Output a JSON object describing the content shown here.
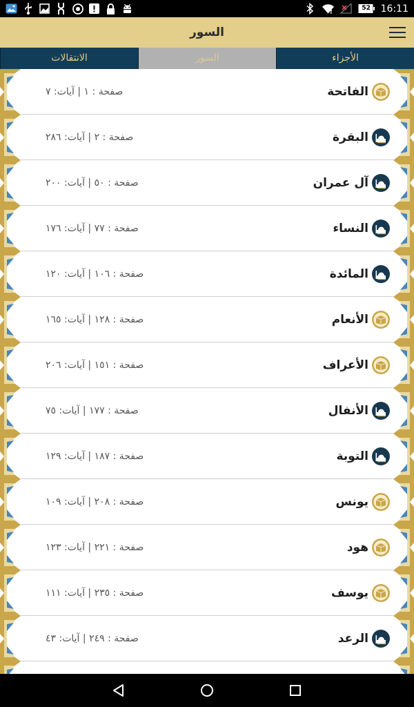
{
  "status_bar": {
    "time": "16:11",
    "battery_level": "52",
    "left_icons": [
      "gallery-icon",
      "usb-icon",
      "image-icon",
      "usb-debug-icon",
      "vpn-icon",
      "alert-icon",
      "lock-icon",
      "android-icon"
    ],
    "right_icons": [
      "bluetooth-icon",
      "wifi-icon",
      "signal-icon",
      "battery-icon"
    ]
  },
  "app_bar": {
    "title": "السور",
    "menu_icon": "hamburger-menu-icon"
  },
  "tabs": [
    {
      "label": "الانتقالات",
      "active": false
    },
    {
      "label": "السور",
      "active": true
    },
    {
      "label": "الأجزاء",
      "active": false
    }
  ],
  "colors": {
    "app_bar": "#e3cf8b",
    "tab_bar": "#123d58",
    "tab_active": "#b1b1b1",
    "gold": "#c9a64a",
    "navy": "#17384f"
  },
  "suras": [
    {
      "name": "الفاتحة",
      "info": "صفحة : ١ | آيات: ٧",
      "icon": "kaaba-icon"
    },
    {
      "name": "البقرة",
      "info": "صفحة : ٢ | آيات: ٢٨٦",
      "icon": "mosque-icon"
    },
    {
      "name": "آل عمران",
      "info": "صفحة : ٥٠ | آيات: ٢٠٠",
      "icon": "mosque-icon"
    },
    {
      "name": "النساء",
      "info": "صفحة : ٧٧ | آيات: ١٧٦",
      "icon": "mosque-icon"
    },
    {
      "name": "المائدة",
      "info": "صفحة : ١٠٦ | آيات: ١٢٠",
      "icon": "mosque-icon"
    },
    {
      "name": "الأنعام",
      "info": "صفحة : ١٢٨ | آيات: ١٦٥",
      "icon": "kaaba-icon"
    },
    {
      "name": "الأعراف",
      "info": "صفحة : ١٥١ | آيات: ٢٠٦",
      "icon": "kaaba-icon"
    },
    {
      "name": "الأنفال",
      "info": "صفحة : ١٧٧ | آيات: ٧٥",
      "icon": "mosque-icon"
    },
    {
      "name": "التوبة",
      "info": "صفحة : ١٨٧ | آيات: ١٢٩",
      "icon": "mosque-icon"
    },
    {
      "name": "يونس",
      "info": "صفحة : ٢٠٨ | آيات: ١٠٩",
      "icon": "kaaba-icon"
    },
    {
      "name": "هود",
      "info": "صفحة : ٢٢١ | آيات: ١٢٣",
      "icon": "kaaba-icon"
    },
    {
      "name": "يوسف",
      "info": "صفحة : ٢٣٥ | آيات: ١١١",
      "icon": "kaaba-icon"
    },
    {
      "name": "الرعد",
      "info": "صفحة : ٢٤٩ | آيات: ٤٣",
      "icon": "mosque-icon"
    }
  ],
  "nav_bar": {
    "buttons": [
      "back-icon",
      "home-icon",
      "recents-icon"
    ]
  }
}
